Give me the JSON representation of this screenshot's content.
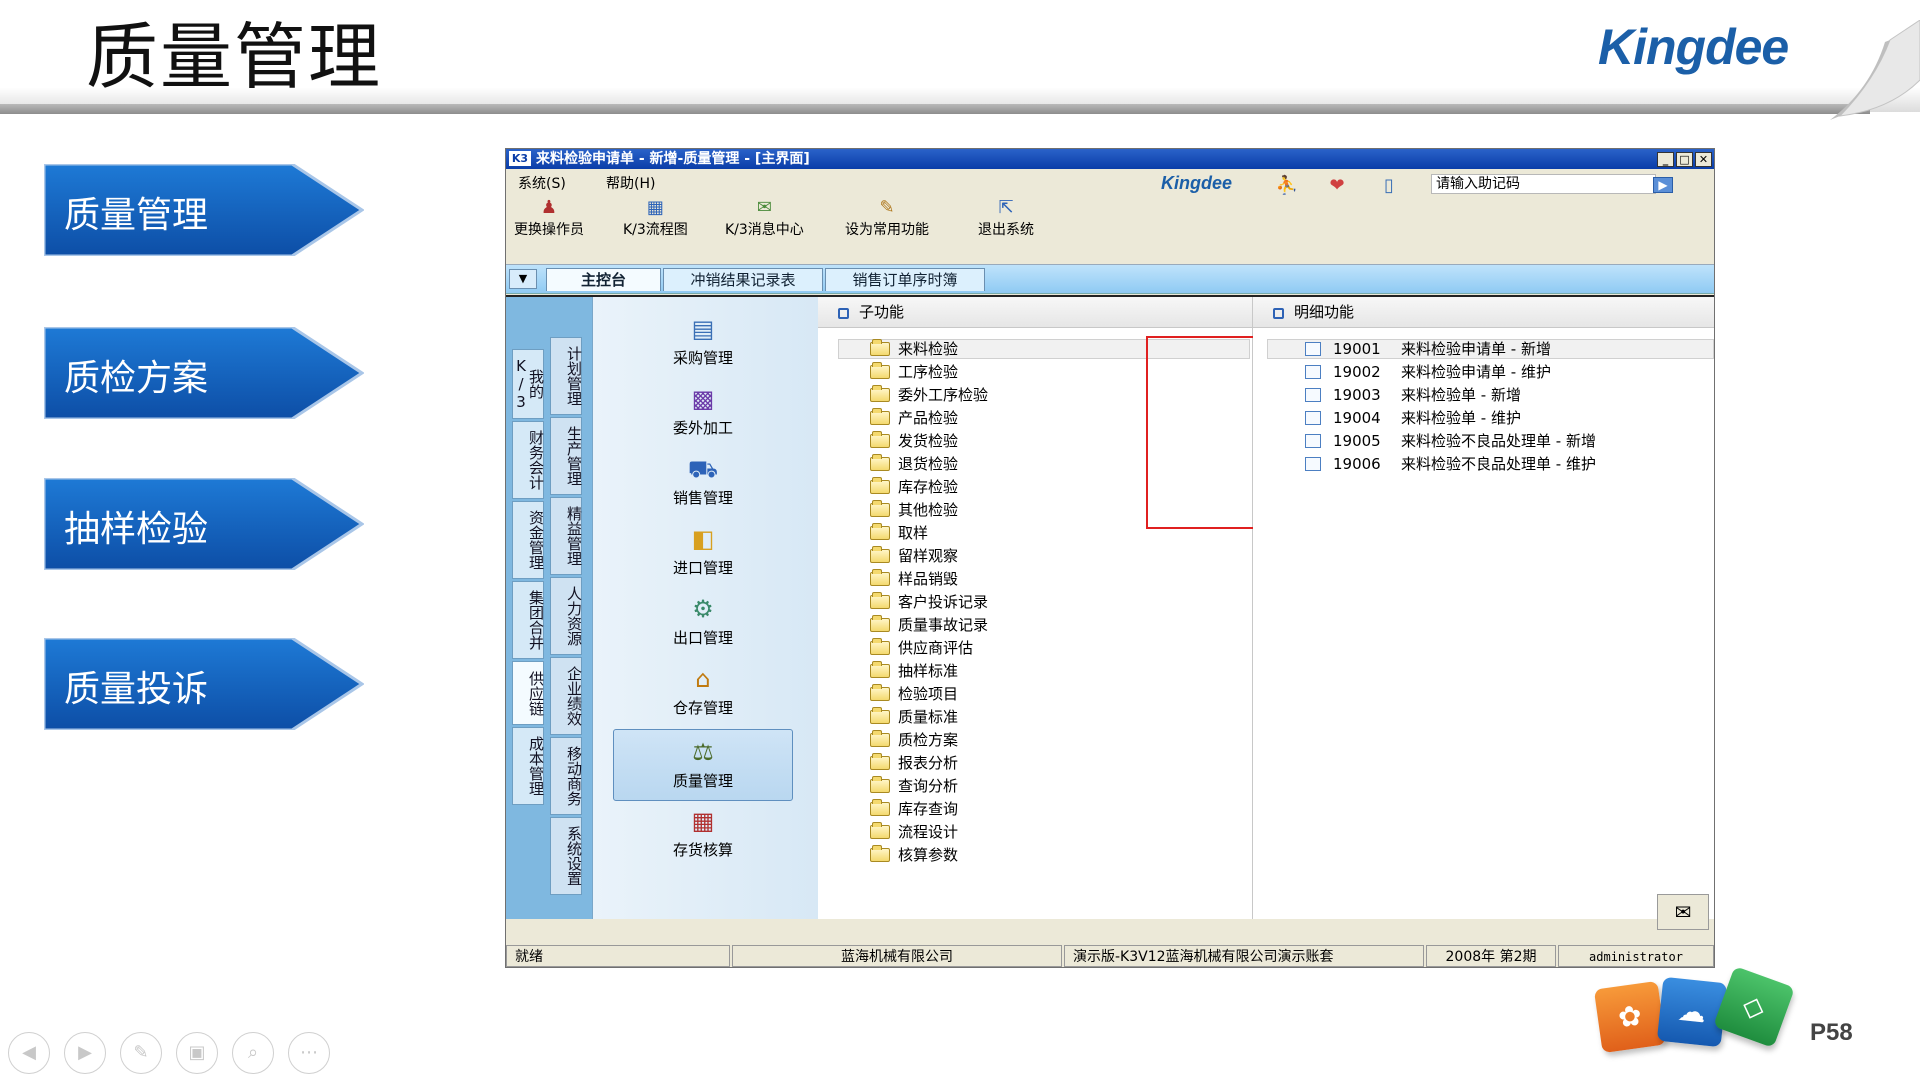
{
  "slide": {
    "title": "质量管理",
    "logo": "Kingdee",
    "page_number": "P58",
    "nav": [
      "质量管理",
      "质检方案",
      "抽样检验",
      "质量投诉"
    ],
    "nav_color": "#1565c0",
    "controls": [
      "prev-icon",
      "play-icon",
      "pen-icon",
      "layout-icon",
      "zoom-icon",
      "more-icon"
    ]
  },
  "window": {
    "app_icon": "K3",
    "title": "来料检验申请单 - 新增-质量管理 - [主界面]",
    "title_bar_color": "#0a3da8",
    "menus": [
      "系统(S)",
      "帮助(H)"
    ],
    "logo_small": "Kingdee",
    "help_code_placeholder": "请输入助记码",
    "toolbar": [
      "更换操作员",
      "K/3流程图",
      "K/3消息中心",
      "设为常用功能",
      "退出系统"
    ],
    "tabs": [
      "主控台",
      "冲销结果记录表",
      "销售订单序时簿"
    ],
    "active_tab": "主控台",
    "side_tabs_col1": [
      "我的K/3",
      "财务会计",
      "资金管理",
      "集团合并",
      "供应链",
      "成本管理"
    ],
    "side_tabs_col2": [
      "计划管理",
      "生产管理",
      "精益管理",
      "人力资源",
      "企业绩效",
      "移动商务",
      "系统设置"
    ],
    "modules": [
      "采购管理",
      "委外加工",
      "销售管理",
      "进口管理",
      "出口管理",
      "仓存管理",
      "质量管理",
      "存货核算"
    ],
    "selected_module": "质量管理",
    "sub_header": "子功能",
    "detail_header": "明细功能",
    "sub_functions": [
      "来料检验",
      "工序检验",
      "委外工序检验",
      "产品检验",
      "发货检验",
      "退货检验",
      "库存检验",
      "其他检验",
      "取样",
      "留样观察",
      "样品销毁",
      "客户投诉记录",
      "质量事故记录",
      "供应商评估",
      "抽样标准",
      "检验项目",
      "质量标准",
      "质检方案",
      "报表分析",
      "查询分析",
      "库存查询",
      "流程设计",
      "核算参数"
    ],
    "details": [
      {
        "code": "19001",
        "name": "来料检验申请单 - 新增"
      },
      {
        "code": "19002",
        "name": "来料检验申请单 - 维护"
      },
      {
        "code": "19003",
        "name": "来料检验单 - 新增"
      },
      {
        "code": "19004",
        "name": "来料检验单 - 维护"
      },
      {
        "code": "19005",
        "name": "来料检验不良品处理单 - 新增"
      },
      {
        "code": "19006",
        "name": "来料检验不良品处理单 - 维护"
      }
    ],
    "highlight_color": "#e02020",
    "status": [
      "就绪",
      "蓝海机械有限公司",
      "演示版-K3V12蓝海机械有限公司演示账套",
      "2008年 第2期",
      "administrator"
    ]
  }
}
